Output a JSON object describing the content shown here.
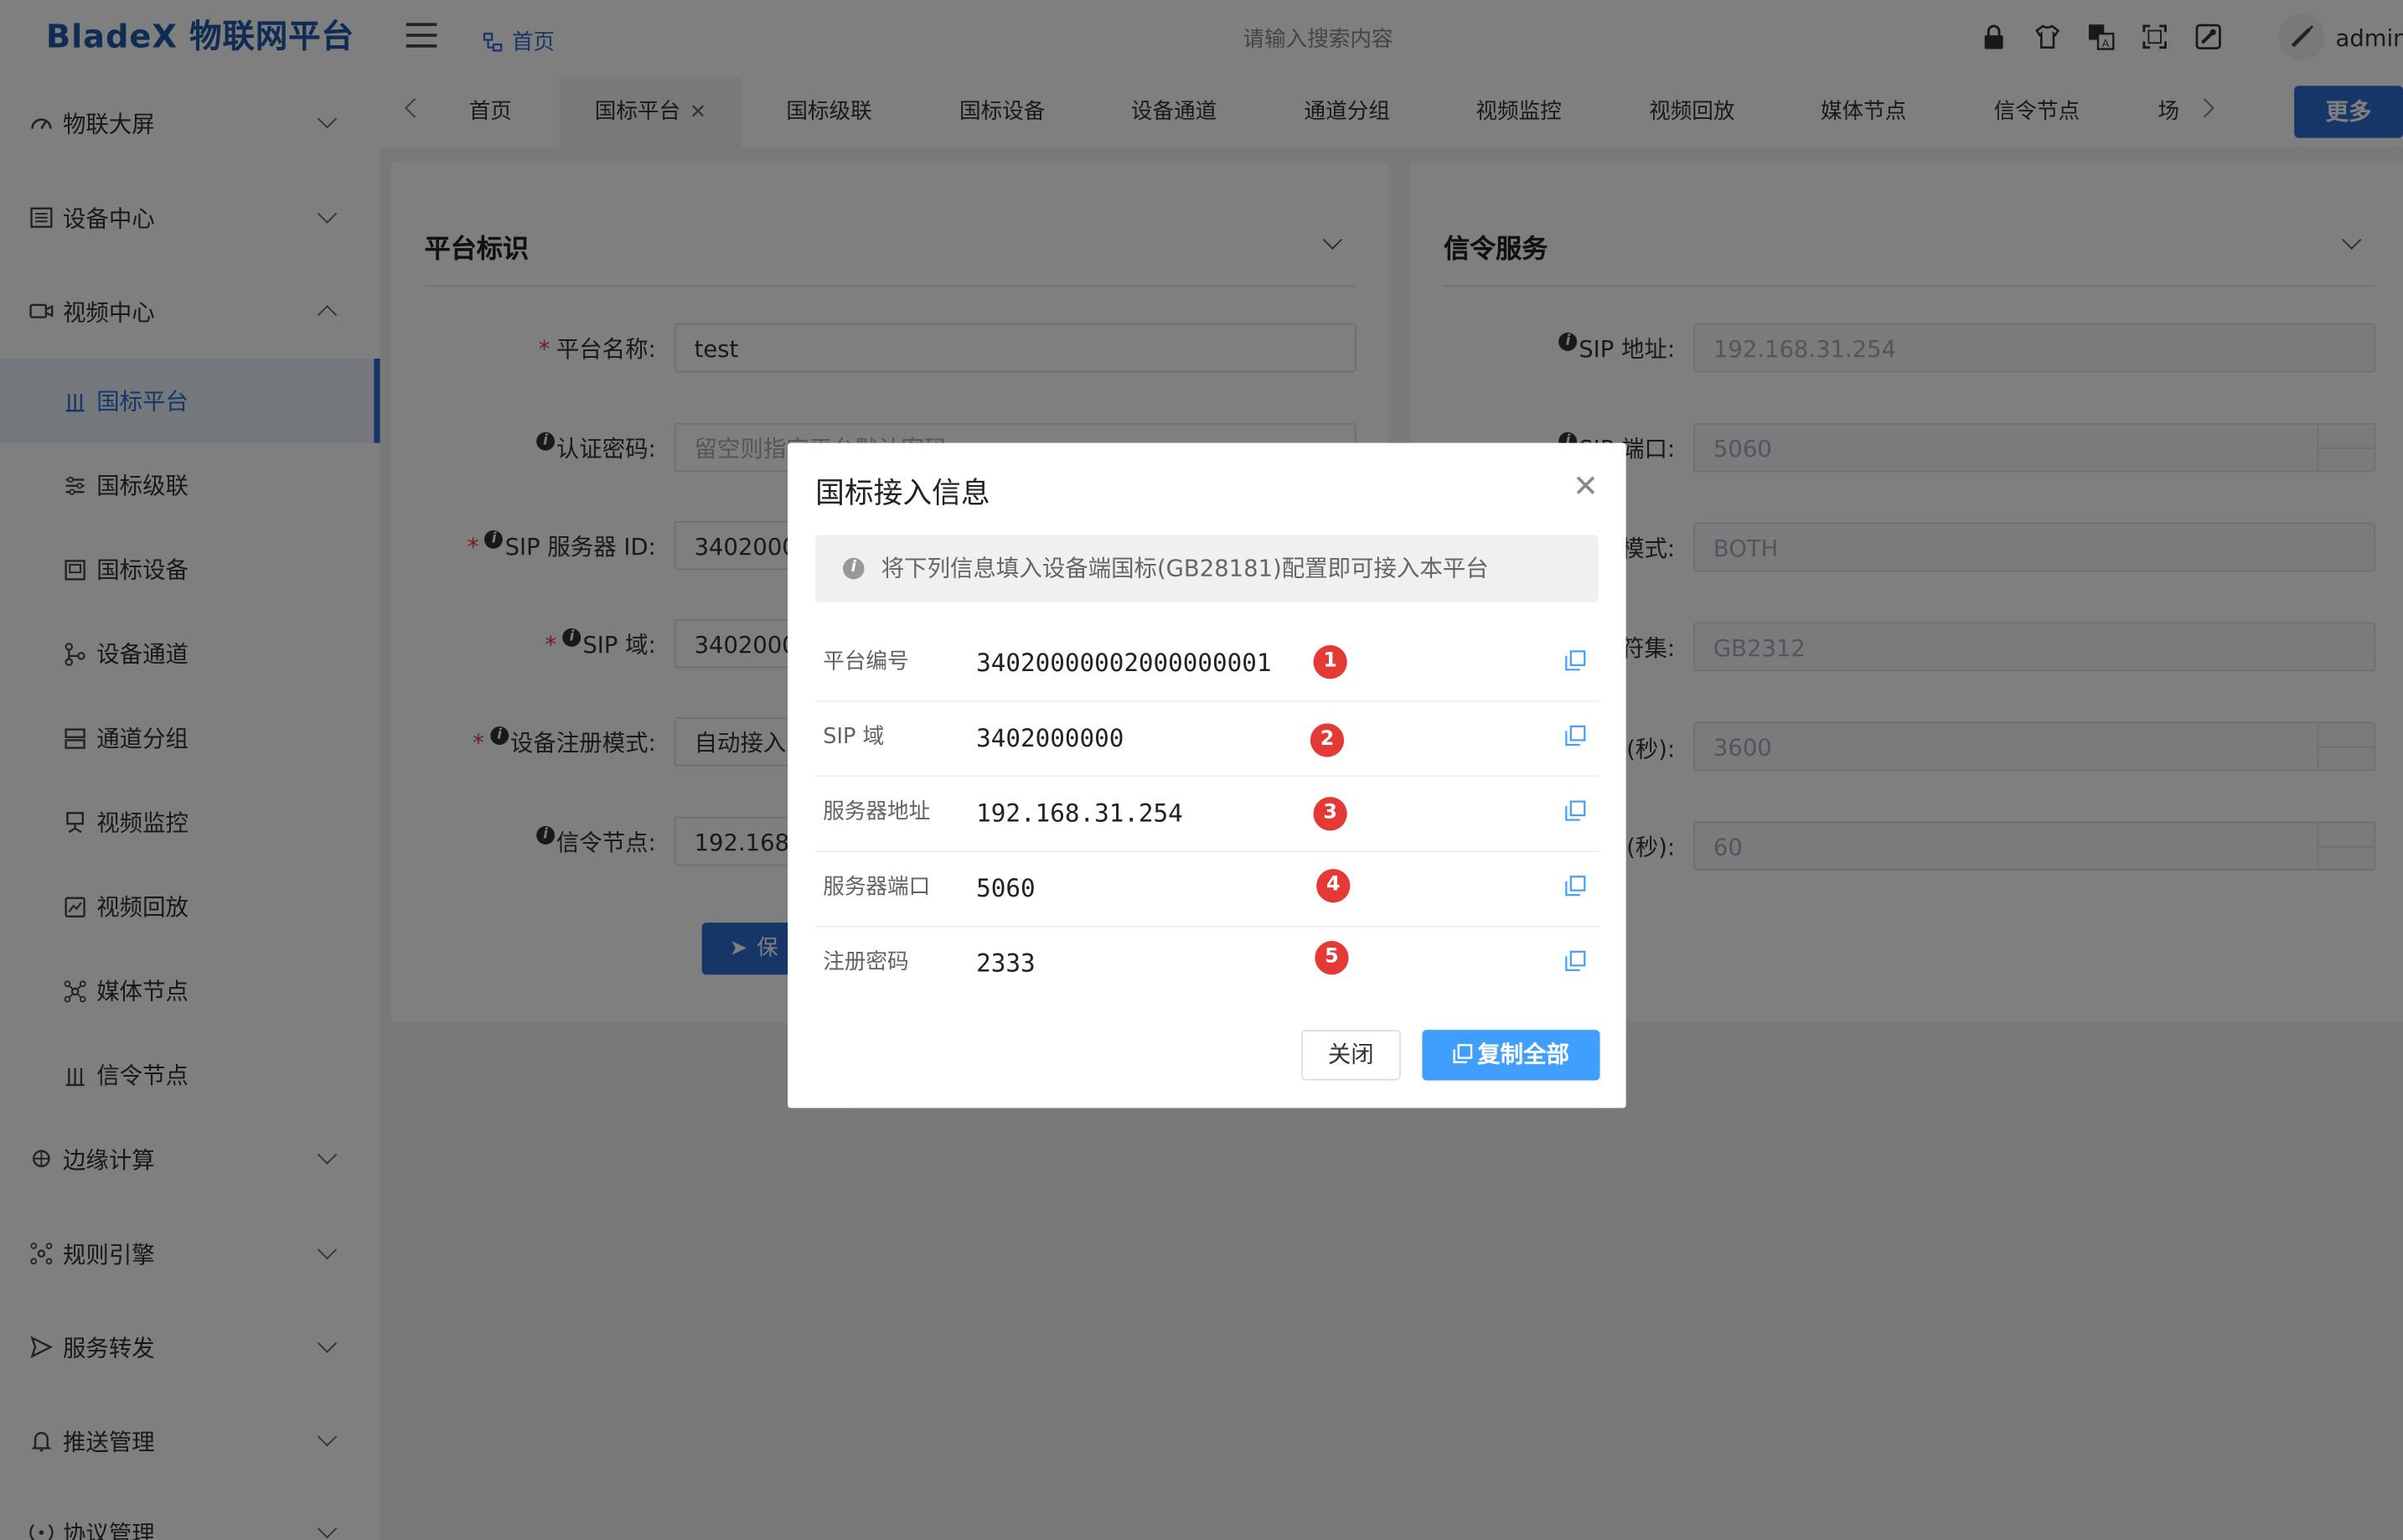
{
  "app": {
    "title": "BladeX 物联网平台",
    "user": "admin"
  },
  "header": {
    "home_label": "首页",
    "search_placeholder": "请输入搜索内容"
  },
  "sidebar": {
    "groups": [
      {
        "label": "物联大屏",
        "icon": "dashboard-icon",
        "expanded": false
      },
      {
        "label": "设备中心",
        "icon": "device-list-icon",
        "expanded": false
      },
      {
        "label": "视频中心",
        "icon": "video-camera-icon",
        "expanded": true
      },
      {
        "label": "边缘计算",
        "icon": "edge-compute-icon",
        "expanded": false
      },
      {
        "label": "规则引擎",
        "icon": "rule-engine-icon",
        "expanded": false
      },
      {
        "label": "服务转发",
        "icon": "send-icon",
        "expanded": false
      },
      {
        "label": "推送管理",
        "icon": "bell-icon",
        "expanded": false
      },
      {
        "label": "协议管理",
        "icon": "protocol-icon",
        "expanded": false
      }
    ],
    "video_sub_items": [
      {
        "label": "国标平台",
        "icon": "platform-icon",
        "active": true
      },
      {
        "label": "国标级联",
        "icon": "cascade-icon"
      },
      {
        "label": "国标设备",
        "icon": "device-icon"
      },
      {
        "label": "设备通道",
        "icon": "channel-icon"
      },
      {
        "label": "通道分组",
        "icon": "group-icon"
      },
      {
        "label": "视频监控",
        "icon": "monitor-icon"
      },
      {
        "label": "视频回放",
        "icon": "playback-icon"
      },
      {
        "label": "媒体节点",
        "icon": "media-node-icon"
      },
      {
        "label": "信令节点",
        "icon": "signal-node-icon"
      }
    ]
  },
  "tabs": {
    "items": [
      "首页",
      "国标平台",
      "国标级联",
      "国标设备",
      "设备通道",
      "通道分组",
      "视频监控",
      "视频回放",
      "媒体节点",
      "信令节点",
      "场"
    ],
    "active_index": 1,
    "more_label": "更多"
  },
  "left_card": {
    "title": "平台标识",
    "fields": [
      {
        "label": "平台名称:",
        "value": "test",
        "required": true,
        "info": false
      },
      {
        "label": "认证密码:",
        "placeholder": "留空则指定平台默认密码",
        "required": false,
        "info": true
      },
      {
        "label": "SIP 服务器 ID:",
        "value": "3402000",
        "required": true,
        "info": true
      },
      {
        "label": "SIP 域:",
        "value": "3402000",
        "required": true,
        "info": true
      },
      {
        "label": "设备注册模式:",
        "value": "自动接入",
        "required": true,
        "info": true
      },
      {
        "label": "信令节点:",
        "value": "192.168.",
        "required": false,
        "info": true
      }
    ],
    "save_label": "保"
  },
  "right_card": {
    "title": "信令服务",
    "fields": [
      {
        "label": "SIP 地址:",
        "value": "192.168.31.254"
      },
      {
        "label": "SIP 端口:",
        "value": "5060"
      },
      {
        "label": "模式:",
        "value": "BOTH"
      },
      {
        "label": "符集:",
        "value": "GB2312"
      },
      {
        "label": "(秒):",
        "value": "3600"
      },
      {
        "label": "(秒):",
        "value": "60"
      }
    ]
  },
  "dialog": {
    "title": "国标接入信息",
    "alert": "将下列信息填入设备端国标(GB28181)配置即可接入本平台",
    "rows": [
      {
        "key": "平台编号",
        "value": "34020000002000000001",
        "badge": "1"
      },
      {
        "key": "SIP 域",
        "value": "3402000000",
        "badge": "2"
      },
      {
        "key": "服务器地址",
        "value": "192.168.31.254",
        "badge": "3"
      },
      {
        "key": "服务器端口",
        "value": "5060",
        "badge": "4"
      },
      {
        "key": "注册密码",
        "value": "2333",
        "badge": "5"
      }
    ],
    "close_label": "关闭",
    "copy_all_label": "复制全部"
  },
  "colors": {
    "brand": "#1f5aa6",
    "primary": "#2c6ccf",
    "accent": "#409eff",
    "badge": "#e53935"
  }
}
